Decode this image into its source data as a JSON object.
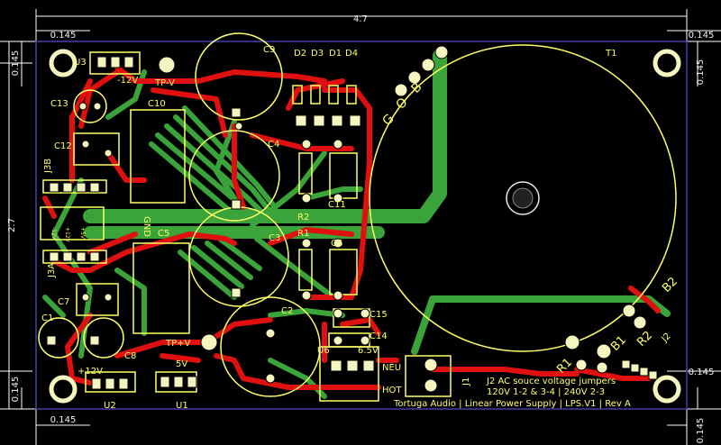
{
  "colors": {
    "background": "#000000",
    "outline": "#4a3aa8",
    "dimension": "#e8e8e8",
    "silk": "#ffff66",
    "top_copper": "#e01010",
    "bottom_copper": "#3aa33a",
    "pad": "#f5f5c0"
  },
  "dimensions": {
    "width": "4.7",
    "height": "2.7",
    "m_top_left": "0.145",
    "m_top_right": "0.145",
    "m_left_top": "0.145",
    "m_right_top": "0.145",
    "m_left_bottom": "0.145",
    "m_right_bottom": "0.145",
    "m_bottom_left": "0.145",
    "m_bottom_right": "0.145"
  },
  "labels": {
    "u3": "U3",
    "minus12v": "-12V",
    "tpv": "TP-V",
    "c13": "C13",
    "c10": "C10",
    "c9": "C9",
    "d2": "D2",
    "d3": "D3",
    "d1": "D1",
    "d4": "D4",
    "t1": "T1",
    "g": "G",
    "o": "O",
    "b": "B",
    "c12": "C12",
    "c4": "C4",
    "j3b": "J3B",
    "c11": "C11",
    "r2": "R2",
    "gnd": "GND",
    "r1": "R1",
    "c3": "C3",
    "c5": "C5",
    "c6": "C6",
    "j3a": "J3A",
    "c7": "C7",
    "c1": "C1",
    "c2": "C2",
    "c15": "C15",
    "c14": "C14",
    "u6": "U6",
    "v65": "6.5V",
    "c8": "C8",
    "tppv": "TP+V",
    "v5": "5V",
    "plus12v": "+12V",
    "u2": "U2",
    "u1": "U1",
    "neu": "NEU",
    "hot": "HOT",
    "j1": "J1",
    "b2": "B2",
    "r2b": "R2",
    "b1": "B1",
    "r1b": "R1",
    "j2": "J2",
    "j3b_pin1": "-12V",
    "j3b_pin2": "+12V",
    "j3b_pin3": "+5V",
    "jumper_title": "J2 AC souce voltage jumpers",
    "jumper_note": "120V 1-2 & 3-4 | 240V 2-3",
    "footer": "Tortuga Audio | Linear Power Supply | LPS.V1 | Rev A"
  }
}
